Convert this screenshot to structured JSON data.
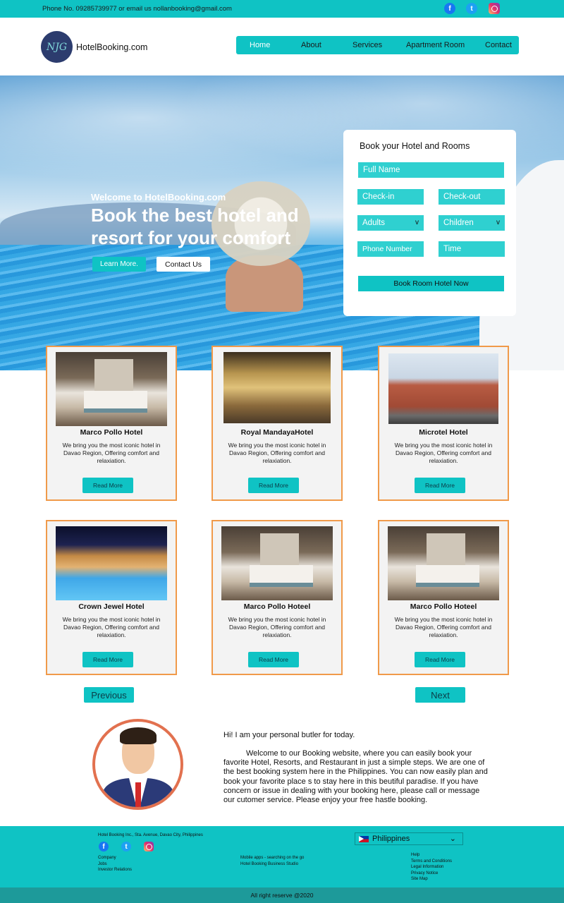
{
  "topbar": {
    "contact_text": "Phone No. 09285739977 or email us nollanbooking@gmail.com"
  },
  "header": {
    "logo_text": "NJG",
    "brand": "HotelBooking.com"
  },
  "nav": [
    "Home",
    "About",
    "Services",
    "Apartment Room",
    "Contact"
  ],
  "hero": {
    "welcome": "Welcome to HotelBooking.com",
    "headline": "Book the best hotel and resort for your comfort",
    "learn_more": "Learn More.",
    "contact_us": "Contact Us"
  },
  "booking_form": {
    "title": "Book your Hotel and Rooms",
    "full_name": "Full Name",
    "check_in": "Check-in",
    "check_out": "Check-out",
    "adults": "Adults",
    "children": "Children",
    "dropdown_arrow": "v",
    "phone": "Phone Number",
    "time": "Time",
    "submit": "Book Room Hotel Now"
  },
  "hotels": [
    {
      "name": "Marco Pollo Hotel",
      "desc": "We bring you the most iconic hotel in Davao Region, Offering comfort and relaxiation.",
      "button": "Read More",
      "image": "hotel-room"
    },
    {
      "name": "Royal MandayaHotel",
      "desc": "We bring you the most iconic hotel in Davao Region, Offering comfort and relaxiation.",
      "button": "Read More",
      "image": "restaurant"
    },
    {
      "name": "Microtel Hotel",
      "desc": "We bring you the most iconic hotel in Davao Region, Offering comfort and relaxiation.",
      "button": "Read More",
      "image": "hotel-exterior"
    },
    {
      "name": "Crown Jewel Hotel",
      "desc": "We bring you the most iconic hotel in Davao Region, Offering comfort and relaxiation.",
      "button": "Read More",
      "image": "pool-night"
    },
    {
      "name": "Marco Pollo Hoteel",
      "desc": "We bring you the most iconic hotel in Davao Region, Offering comfort and relaxiation.",
      "button": "Read More",
      "image": "hotel-room"
    },
    {
      "name": "Marco Pollo Hoteel",
      "desc": "We bring you the most iconic hotel in Davao Region, Offering comfort and relaxiation.",
      "button": "Read More",
      "image": "hotel-room"
    }
  ],
  "pagination": {
    "previous": "Previous",
    "next": "Next"
  },
  "butler": {
    "greeting": "Hi! I am your personal butler for today.",
    "message": "Welcome to our Booking website, where you can easily book your favorite Hotel, Resorts, and Restaurant in just a simple steps. We are one of the best booking system here in the Philippines. You can now easily plan and book your favorite place s to stay here in this beutiful paradise. If you have concern or issue in dealing with your booking here, please call or message our cutomer service. Please enjoy your free hastle booking."
  },
  "footer": {
    "address": "Hotel Booking Inc., Sta. Avenue, Davao City, Philippines",
    "links_left": [
      "Company",
      "Jobs",
      "Investor Relations"
    ],
    "links_middle": [
      "Mobile apps - searching on the go",
      "Hotel Booking Business Studio"
    ],
    "links_right": [
      "Help",
      "Terms and Conditions",
      "Legal Information",
      "Privacy Notice",
      "Site Map"
    ],
    "country": "Philippines",
    "copyright": "All right reserve @2020"
  },
  "colors": {
    "accent": "#0fc3c4",
    "card_border": "#f09a4a",
    "avatar_ring": "#e2714f"
  },
  "icons": [
    "facebook-icon",
    "twitter-icon",
    "instagram-icon",
    "chevron-down-icon",
    "philippines-flag-icon"
  ]
}
